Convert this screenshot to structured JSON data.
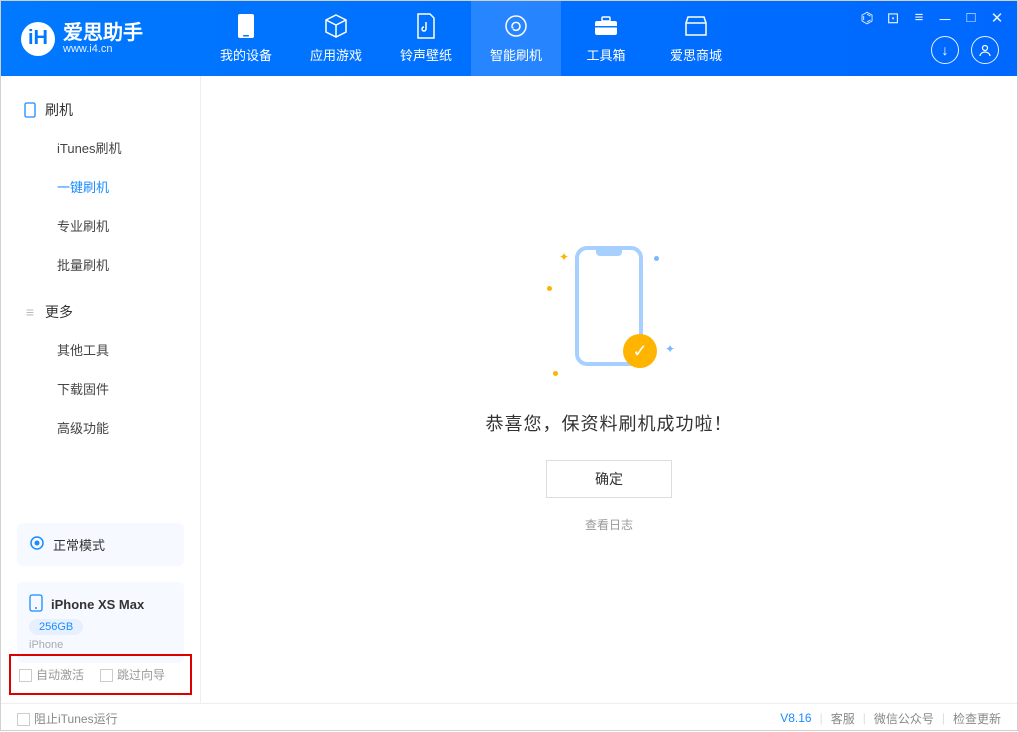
{
  "app": {
    "name": "爱思助手",
    "domain": "www.i4.cn"
  },
  "nav": {
    "tabs": [
      {
        "label": "我的设备"
      },
      {
        "label": "应用游戏"
      },
      {
        "label": "铃声壁纸"
      },
      {
        "label": "智能刷机"
      },
      {
        "label": "工具箱"
      },
      {
        "label": "爱思商城"
      }
    ]
  },
  "sidebar": {
    "section1": {
      "title": "刷机",
      "items": [
        {
          "label": "iTunes刷机"
        },
        {
          "label": "一键刷机"
        },
        {
          "label": "专业刷机"
        },
        {
          "label": "批量刷机"
        }
      ]
    },
    "section2": {
      "title": "更多",
      "items": [
        {
          "label": "其他工具"
        },
        {
          "label": "下载固件"
        },
        {
          "label": "高级功能"
        }
      ]
    },
    "mode_label": "正常模式",
    "device": {
      "name": "iPhone XS Max",
      "capacity": "256GB",
      "type": "iPhone"
    },
    "opt1": "自动激活",
    "opt2": "跳过向导"
  },
  "main": {
    "success_message": "恭喜您，保资料刷机成功啦！",
    "ok_label": "确定",
    "log_link": "查看日志"
  },
  "footer": {
    "block_itunes": "阻止iTunes运行",
    "version": "V8.16",
    "links": [
      "客服",
      "微信公众号",
      "检查更新"
    ]
  }
}
